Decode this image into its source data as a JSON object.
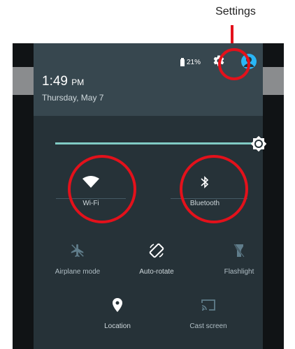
{
  "callout": {
    "label": "Settings"
  },
  "colors": {
    "annotation": "#e3111b",
    "shade_bg": "#263238",
    "header_bg": "#37474f",
    "slider": "#80cbc4",
    "avatar": "#29b6f6"
  },
  "header": {
    "battery": "21%",
    "time": "1:49",
    "ampm": "PM",
    "date": "Thursday, May 7",
    "settings_icon": "gear-icon",
    "account_icon": "account-circle-icon"
  },
  "brightness": {
    "icon": "brightness-icon",
    "level": 1.0
  },
  "tiles": {
    "wifi": {
      "label": "Wi-Fi",
      "icon": "wifi-icon"
    },
    "bluetooth": {
      "label": "Bluetooth",
      "icon": "bluetooth-icon"
    },
    "airplane": {
      "label": "Airplane mode",
      "icon": "airplane-icon"
    },
    "autorotate": {
      "label": "Auto-rotate",
      "icon": "rotate-icon"
    },
    "flashlight": {
      "label": "Flashlight",
      "icon": "flashlight-icon"
    },
    "location": {
      "label": "Location",
      "icon": "location-pin-icon"
    },
    "cast": {
      "label": "Cast screen",
      "icon": "cast-icon"
    }
  }
}
